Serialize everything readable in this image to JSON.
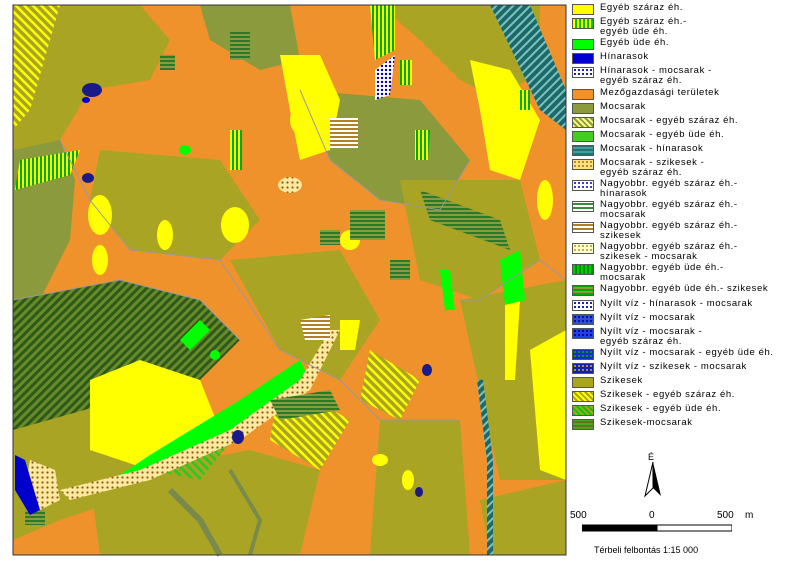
{
  "legend": [
    {
      "label": "Egyéb száraz éh.",
      "pattern": "solid",
      "c1": "#ffff00"
    },
    {
      "label": "Egyéb száraz éh.-\negyéb üde éh.",
      "pattern": "vstripe",
      "c1": "#ffff00",
      "c2": "#00c000"
    },
    {
      "label": "Egyéb üde éh.",
      "pattern": "solid",
      "c1": "#00ff00"
    },
    {
      "label": "Hínarasok",
      "pattern": "solid",
      "c1": "#0000cc"
    },
    {
      "label": "Hínarasok - mocsarak -\negyéb száraz éh.",
      "pattern": "dots",
      "c1": "#ffffff",
      "c2": "#0000aa"
    },
    {
      "label": "Mezőgazdasági területek",
      "pattern": "solid",
      "c1": "#f0922c"
    },
    {
      "label": "Mocsarak",
      "pattern": "solid",
      "c1": "#8a9a3c"
    },
    {
      "label": "Mocsarak - egyéb száraz éh.",
      "pattern": "dstripe",
      "c1": "#ffff80",
      "c2": "#8a9a3c"
    },
    {
      "label": "Mocsarak - egyéb üde éh.",
      "pattern": "solid",
      "c1": "#44cc22"
    },
    {
      "label": "Mocsarak - hínarasok",
      "pattern": "hstripe",
      "c1": "#2a7070",
      "c2": "#40a0a0"
    },
    {
      "label": "Mocsarak - szikesek -\negyéb száraz éh.",
      "pattern": "dots",
      "c1": "#ffe080",
      "c2": "#b08020"
    },
    {
      "label": "Nagyobbr. egyéb száraz éh.-\nhínarasok",
      "pattern": "dots",
      "c1": "#ffffff",
      "c2": "#2020cc"
    },
    {
      "label": "Nagyobbr. egyéb száraz éh.-\nmocsarak",
      "pattern": "hstripe",
      "c1": "#ffffff",
      "c2": "#3a8a3a"
    },
    {
      "label": "Nagyobbr. egyéb száraz éh.-\nszikesek",
      "pattern": "hstripe",
      "c1": "#ffffff",
      "c2": "#b0802a"
    },
    {
      "label": "Nagyobbr. egyéb száraz éh.-\nszikesek - mocsarak",
      "pattern": "dots",
      "c1": "#ffffcc",
      "c2": "#c0a040"
    },
    {
      "label": "Nagyobbr. egyéb üde éh.-\nmocsarak",
      "pattern": "vstripe",
      "c1": "#00cc00",
      "c2": "#008800"
    },
    {
      "label": "Nagyobbr. egyéb üde éh.- szikesek",
      "pattern": "hstripe",
      "c1": "#00aa00",
      "c2": "#8a9a3c"
    },
    {
      "label": "Nyílt víz - hínarasok - mocsarak",
      "pattern": "dots",
      "c1": "#ffffff",
      "c2": "#0000aa"
    },
    {
      "label": "Nyílt víz - mocsarak",
      "pattern": "dots",
      "c1": "#3050cc",
      "c2": "#0000aa"
    },
    {
      "label": "Nyílt víz - mocsarak -\negyéb száraz éh.",
      "pattern": "dots",
      "c1": "#2040ee",
      "c2": "#000088"
    },
    {
      "label": "Nyílt víz - mocsarak - egyéb üde éh.",
      "pattern": "dots",
      "c1": "#1030cc",
      "c2": "#00aa00"
    },
    {
      "label": "Nyílt víz - szikesek - mocsarak",
      "pattern": "dots",
      "c1": "#1020aa",
      "c2": "#b0a040"
    },
    {
      "label": "Szikesek",
      "pattern": "solid",
      "c1": "#a9a424"
    },
    {
      "label": "Szikesek - egyéb száraz éh.",
      "pattern": "dstripe",
      "c1": "#ffff00",
      "c2": "#a9a424"
    },
    {
      "label": "Szikesek - egyéb üde éh.",
      "pattern": "dstripe",
      "c1": "#00cc00",
      "c2": "#a9a424"
    },
    {
      "label": "Szikesek-mocsarak",
      "pattern": "hstripe",
      "c1": "#44aa22",
      "c2": "#6a7020"
    }
  ],
  "north_label": "É",
  "scale": {
    "left": "500",
    "mid": "0",
    "right": "500",
    "unit": "m"
  },
  "resolution": "Térbeli felbontás 1:15 000",
  "colors": {
    "agri": "#f0922c",
    "szikesek": "#a9a424",
    "mocsarak": "#8a9a3c",
    "yellow": "#ffff00",
    "green": "#00ff00",
    "water": "#0000cc"
  }
}
